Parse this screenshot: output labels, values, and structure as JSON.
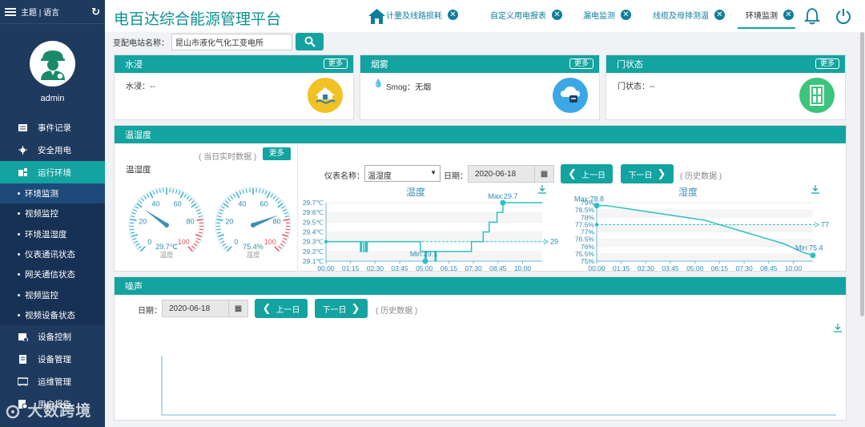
{
  "sidebar": {
    "top_label": "主题 | 语言",
    "user": "admin",
    "menu": [
      {
        "label": "事件记录",
        "icon": "record-icon"
      },
      {
        "label": "安全用电",
        "icon": "safety-icon"
      },
      {
        "label": "运行环境",
        "icon": "environment-icon"
      }
    ],
    "sub_items": [
      "环境监测",
      "视频监控",
      "环境温湿度",
      "仪表通讯状态",
      "网关通信状态",
      "视频监控",
      "视频设备状态"
    ],
    "menu2": [
      {
        "label": "设备控制",
        "icon": "control-icon"
      },
      {
        "label": "设备管理",
        "icon": "device-icon"
      },
      {
        "label": "运维管理",
        "icon": "ops-icon"
      },
      {
        "label": "用户报告",
        "icon": "report-icon"
      }
    ],
    "watermark": "大数跨境"
  },
  "header": {
    "title": "电百达综合能源管理平台",
    "tabs": [
      "计量及线路损耗",
      "自定义用电报表",
      "漏电监测",
      "线缆及母排测温",
      "环境监测"
    ]
  },
  "filter": {
    "label": "变配电站名称：",
    "value": "昆山市液化气化工变电所"
  },
  "cards": {
    "water": {
      "title": "水浸",
      "more": "更多",
      "status": "水浸：--"
    },
    "smoke": {
      "title": "烟雾",
      "more": "更多",
      "status": "Smog：无烟"
    },
    "door": {
      "title": "门状态",
      "more": "更多",
      "status": "门状态：--"
    }
  },
  "th_panel": {
    "title": "温湿度",
    "realtime_note": "( 当日实时数据 )",
    "more": "更多",
    "gauge_label": "温湿度",
    "temp_gauge": {
      "value": 29.7,
      "display": "29.7℃",
      "unit_label": "温度",
      "ticks": [
        "0",
        "20",
        "40",
        "60",
        "80",
        "100"
      ]
    },
    "humid_gauge": {
      "value": 75.4,
      "display": "75.4%",
      "unit_label": "湿度",
      "ticks": [
        "0",
        "20",
        "40",
        "60",
        "80",
        "100"
      ]
    },
    "meter_label": "仪表名称：",
    "meter_value": "温湿度",
    "date_label": "日期：",
    "date": "2020-06-18",
    "prev": "上一日",
    "next": "下一日",
    "history": "( 历史数据 )"
  },
  "noise_panel": {
    "title": "噪声",
    "date_label": "日期：",
    "date": "2020-06-18",
    "prev": "上一日",
    "next": "下一日",
    "history": "( 历史数据 )"
  },
  "chart_data": [
    {
      "type": "line",
      "title": "温度",
      "x_ticks": [
        "00:00",
        "01:15",
        "02:30",
        "03:45",
        "05:00",
        "06:15",
        "07:30",
        "08:45",
        "10:00"
      ],
      "y_ticks": [
        "29.1℃",
        "29.2℃",
        "29.3℃",
        "29.4℃",
        "29.5℃",
        "29.6℃",
        "29.7℃"
      ],
      "ylim": [
        29.1,
        29.7
      ],
      "average": 29,
      "average_label": "29",
      "max_label": "Max:29.7",
      "min_label": "Min:29.1",
      "x": [
        0,
        0.4,
        0.8,
        1.2,
        1.5,
        1.7,
        1.75,
        1.8,
        1.9,
        2.0,
        2.05,
        2.1,
        2.2,
        2.5,
        3.0,
        3.5,
        4.0,
        4.5,
        4.8,
        5.0,
        5.05,
        5.1,
        5.3,
        5.5,
        5.55,
        5.6,
        6.0,
        6.5,
        7.0,
        7.3,
        7.4,
        7.8,
        8.0,
        8.2,
        8.3,
        8.6,
        8.7,
        8.9,
        9.0,
        9.3,
        9.6,
        10.0,
        10.5,
        11.0
      ],
      "y": [
        29.3,
        29.3,
        29.3,
        29.3,
        29.3,
        29.3,
        29.2,
        29.3,
        29.2,
        29.3,
        29.2,
        29.3,
        29.3,
        29.3,
        29.3,
        29.3,
        29.3,
        29.3,
        29.2,
        29.2,
        29.1,
        29.2,
        29.2,
        29.2,
        29.1,
        29.2,
        29.2,
        29.2,
        29.2,
        29.2,
        29.3,
        29.3,
        29.4,
        29.4,
        29.5,
        29.5,
        29.6,
        29.6,
        29.7,
        29.7,
        29.7,
        29.7,
        29.7,
        29.7
      ]
    },
    {
      "type": "line",
      "title": "湿度",
      "x_ticks": [
        "00:00",
        "01:15",
        "02:30",
        "03:45",
        "05:00",
        "06:15",
        "07:30",
        "08:45",
        "10:00"
      ],
      "y_ticks": [
        "75%",
        "75.5%",
        "76%",
        "76.5%",
        "77%",
        "77.5%",
        "78%",
        "78.5%",
        "79%"
      ],
      "ylim": [
        75,
        79
      ],
      "average": 77.5,
      "average_label": "77",
      "max_label": "Max:78.8",
      "min_label": "Min:75.4",
      "x": [
        0,
        0.5,
        1.0,
        1.5,
        2.0,
        2.5,
        3.0,
        3.5,
        4.0,
        4.5,
        5.0,
        5.5,
        6.0,
        6.5,
        7.0,
        7.5,
        8.0,
        8.5,
        9.0,
        9.5,
        10.0,
        10.5,
        11.0
      ],
      "y": [
        78.8,
        78.8,
        78.7,
        78.6,
        78.5,
        78.4,
        78.3,
        78.2,
        78.1,
        78.0,
        77.9,
        77.8,
        77.6,
        77.4,
        77.2,
        77.0,
        76.8,
        76.6,
        76.4,
        76.2,
        75.9,
        75.6,
        75.4
      ]
    }
  ]
}
